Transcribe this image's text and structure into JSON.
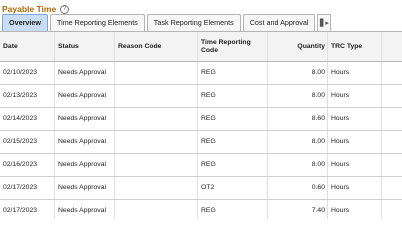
{
  "title": "Payable Time",
  "help_icon": "question-circle-icon",
  "tabs": [
    {
      "label": "Overview",
      "active": true
    },
    {
      "label": "Time Reporting Elements",
      "active": false
    },
    {
      "label": "Task Reporting Elements",
      "active": false
    },
    {
      "label": "Cost and Approval",
      "active": false
    }
  ],
  "more_tabs_icon": "show-all-columns-icon",
  "columns": {
    "date": "Date",
    "status": "Status",
    "reason": "Reason Code",
    "trc": "Time Reporting Code",
    "quantity": "Quantity",
    "trc_type": "TRC Type"
  },
  "rows": [
    {
      "date": "02/10/2023",
      "status": "Needs Approval",
      "reason": "",
      "trc": "REG",
      "quantity": "8.00",
      "trc_type": "Hours"
    },
    {
      "date": "02/13/2023",
      "status": "Needs Approval",
      "reason": "",
      "trc": "REG",
      "quantity": "8.00",
      "trc_type": "Hours"
    },
    {
      "date": "02/14/2023",
      "status": "Needs Approval",
      "reason": "",
      "trc": "REG",
      "quantity": "8.60",
      "trc_type": "Hours"
    },
    {
      "date": "02/15/2023",
      "status": "Needs Approval",
      "reason": "",
      "trc": "REG",
      "quantity": "8.00",
      "trc_type": "Hours"
    },
    {
      "date": "02/16/2023",
      "status": "Needs Approval",
      "reason": "",
      "trc": "REG",
      "quantity": "8.00",
      "trc_type": "Hours"
    },
    {
      "date": "02/17/2023",
      "status": "Needs Approval",
      "reason": "",
      "trc": "OT2",
      "quantity": "0.60",
      "trc_type": "Hours"
    },
    {
      "date": "02/17/2023",
      "status": "Needs Approval",
      "reason": "",
      "trc": "REG",
      "quantity": "7.40",
      "trc_type": "Hours"
    }
  ],
  "colors": {
    "title": "#b26a00",
    "active_tab": "#c9def5",
    "header_bg": "#f3f3f3"
  }
}
